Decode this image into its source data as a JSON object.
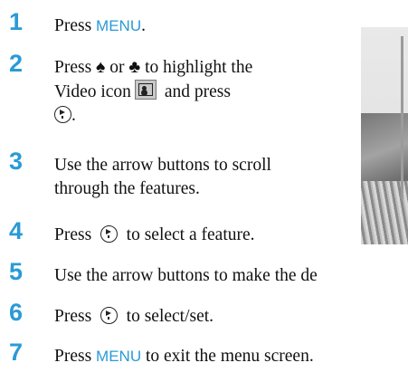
{
  "steps": [
    {
      "num": "1",
      "a": "Press ",
      "kw": "MENU",
      "b": "."
    },
    {
      "num": "2",
      "line1": "Press ♠ or ♣ to highlight the",
      "line2a": "Video icon",
      "line2b": " and press",
      "line3": "."
    },
    {
      "num": "3",
      "line1": "Use the arrow buttons to scroll",
      "line2": "through the features."
    },
    {
      "num": "4",
      "a": "Press",
      "b": "to select a feature."
    },
    {
      "num": "5",
      "text": "Use the arrow buttons to make the de"
    },
    {
      "num": "6",
      "a": "Press",
      "b": "to select/set."
    },
    {
      "num": "7",
      "a": "Press ",
      "kw": "MENU",
      "b": " to exit the menu screen."
    }
  ],
  "colors": {
    "accent": "#2a9ad6"
  },
  "icons": {
    "video": "video-icon",
    "enter": "enter-button-icon"
  }
}
